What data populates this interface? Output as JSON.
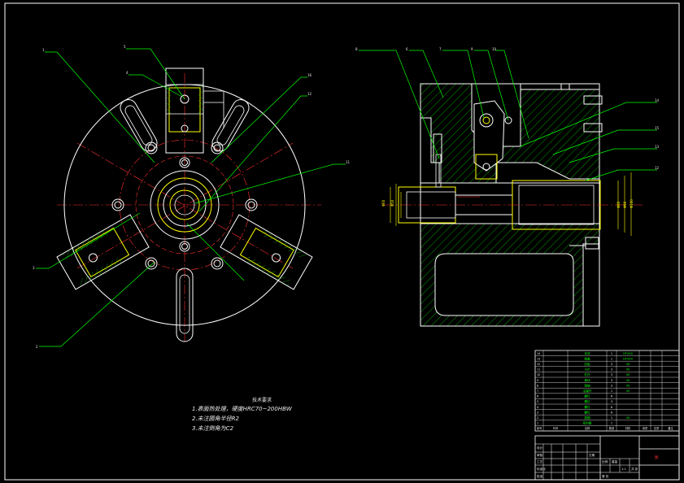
{
  "drawing": {
    "front_view_callouts": [
      "1",
      "5",
      "4",
      "16",
      "12",
      "11",
      "3",
      "2"
    ],
    "section_view_callouts": [
      "8",
      "6",
      "7",
      "9",
      "10",
      "14",
      "15",
      "13",
      "12"
    ]
  },
  "tech_notes": {
    "title": "技术要求",
    "lines": [
      "1.表面热处理，硬度HRC70~200HBW",
      "2.未注圆角半径R2",
      "3.未注倒角为C2"
    ]
  },
  "bom": {
    "rows": [
      {
        "name": "本体",
        "qty": "1",
        "material": "HT200"
      },
      {
        "name": "端盖",
        "qty": "1",
        "material": "HT200"
      },
      {
        "name": "压板",
        "qty": "3",
        "material": "45"
      },
      {
        "name": "卡爪",
        "qty": "3",
        "material": "45"
      },
      {
        "name": "杠杆",
        "qty": "3",
        "material": "45"
      },
      {
        "name": "滑块",
        "qty": "3",
        "material": "45"
      },
      {
        "name": "销轴",
        "qty": "3",
        "material": "45"
      },
      {
        "name": "活塞杆",
        "qty": "1",
        "material": "45"
      },
      {
        "name": "螺钉",
        "qty": "6",
        "material": ""
      },
      {
        "name": "螺钉",
        "qty": "3",
        "material": ""
      },
      {
        "name": "螺钉",
        "qty": "6",
        "material": ""
      },
      {
        "name": "螺钉",
        "qty": "6",
        "material": ""
      },
      {
        "name": "垫圈",
        "qty": "1",
        "material": "45"
      },
      {
        "name": "密封圈",
        "qty": "1",
        "material": ""
      }
    ],
    "header": [
      "序号",
      "代号",
      "名称",
      "数量",
      "材料",
      "单重",
      "总重",
      "备注"
    ]
  },
  "title_block": {
    "drawing_name": "",
    "labels": [
      "设计",
      "审核",
      "工艺",
      "标准化",
      "批准",
      "日期",
      "比例",
      "重量",
      "共 张",
      "第 张"
    ],
    "scale": "1:1",
    "stamp_text": "图"
  },
  "colors": {
    "background": "#000000",
    "outline": "#ffffff",
    "center_lines": "#ff3030",
    "leaders_hatch": "#00ff00",
    "bom_text": "#00ff00",
    "part_outline": "#ffff00"
  }
}
